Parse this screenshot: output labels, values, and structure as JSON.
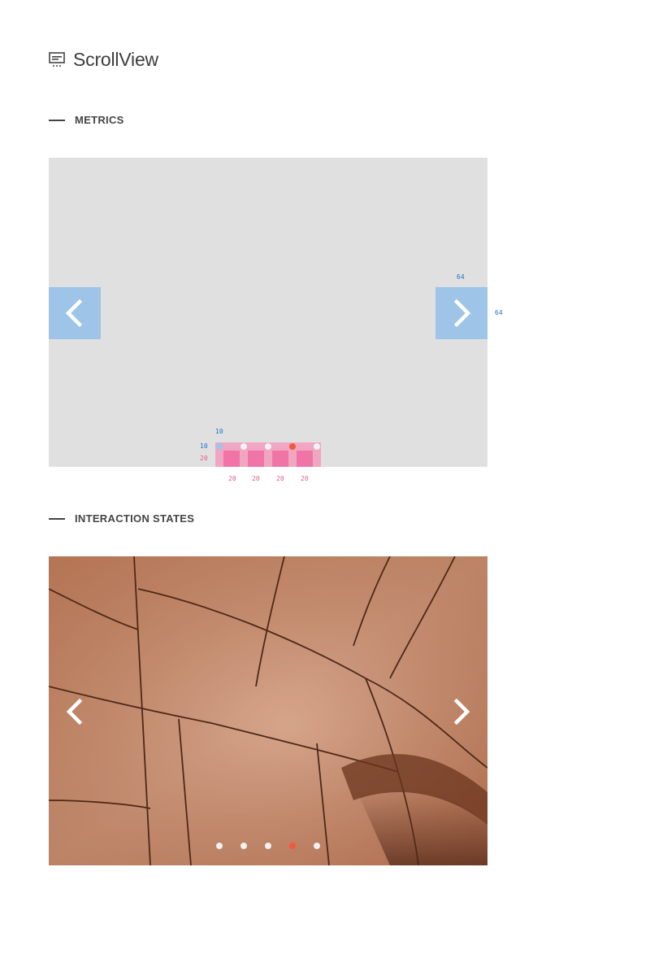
{
  "header": {
    "title": "ScrollView",
    "icon": "carousel-icon"
  },
  "sections": [
    {
      "title": "METRICS"
    },
    {
      "title": "INTERACTION STATES"
    }
  ],
  "metrics": {
    "arrow_width_label": "64",
    "arrow_height_label": "64",
    "indicator_top_label": "10",
    "indicator_left_label": "10",
    "indicator_height_label": "20",
    "indicator_spacing_labels": [
      "20",
      "20",
      "20",
      "20"
    ]
  },
  "pagination": {
    "count": 5,
    "active_index": 3
  },
  "colors": {
    "active_dot": "#f05a3d",
    "inactive_dot": "#f2f2f2",
    "arrow_bg": "#9ec5e8",
    "measure_blue": "#1e74c9",
    "measure_pink": "#e0608a"
  }
}
